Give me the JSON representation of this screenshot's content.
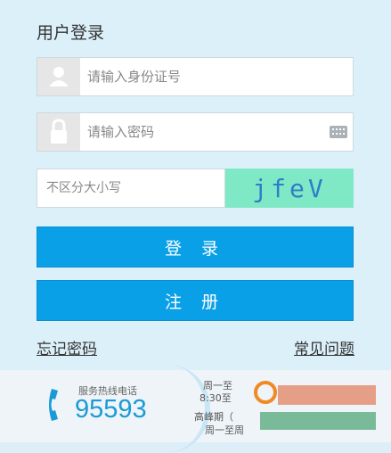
{
  "login": {
    "title": "用户登录",
    "id_placeholder": "请输入身份证号",
    "password_placeholder": "请输入密码",
    "captcha_placeholder": "不区分大小写",
    "captcha_code": "jfeV",
    "login_button": "登 录",
    "register_button": "注 册",
    "forgot_link": "忘记密码",
    "faq_link": "常见问题"
  },
  "footer": {
    "hotline_label": "服务热线电话",
    "hotline_number": "95593",
    "service_lines": [
      "周一至",
      "8:30至",
      "高峰期（",
      "周一至周"
    ]
  },
  "colors": {
    "accent": "#0aa0e8",
    "captcha_bg": "#7fe9c6",
    "panel_bg": "#dcf0fa"
  }
}
